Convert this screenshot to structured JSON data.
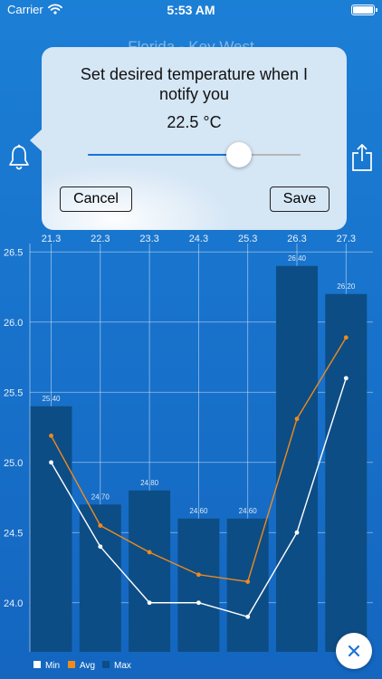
{
  "status_bar": {
    "carrier": "Carrier",
    "time": "5:53 AM"
  },
  "nav": {
    "title": "Florida - Key West"
  },
  "popover": {
    "message": "Set desired temperature when I notify you",
    "value_text": "22.5 °C",
    "slider_fraction": 0.71,
    "cancel_label": "Cancel",
    "save_label": "Save"
  },
  "icons": {
    "left": "bell-icon",
    "right": "share-icon",
    "close": "close-icon"
  },
  "colors": {
    "bar": "#0d4d85",
    "avg": "#f08a1c",
    "min": "#ffffff",
    "accent": "#1a73d9"
  },
  "chart_data": {
    "type": "bar",
    "title": "",
    "x_tick_labels": [
      "21.3",
      "22.3",
      "23.3",
      "24.3",
      "25.3",
      "26.3",
      "27.3"
    ],
    "y_ticks": [
      "24.0",
      "24.5",
      "25.0",
      "25.5",
      "26.0",
      "26.5"
    ],
    "ylim": [
      23.65,
      26.65
    ],
    "grid": true,
    "legend_position": "bottom-left",
    "series": [
      {
        "name": "Max",
        "type": "bar",
        "values": [
          25.4,
          24.7,
          24.8,
          24.6,
          24.6,
          26.4,
          26.2
        ],
        "labels": [
          "25.40",
          "24.70",
          "24.80",
          "24.60",
          "24.60",
          "26.40",
          "26.20"
        ]
      },
      {
        "name": "Avg",
        "type": "line",
        "values": [
          25.19,
          24.55,
          24.36,
          24.2,
          24.15,
          25.31,
          25.89
        ]
      },
      {
        "name": "Min",
        "type": "line",
        "values": [
          25.0,
          24.4,
          24.0,
          24.0,
          23.9,
          24.5,
          25.6
        ]
      }
    ]
  }
}
